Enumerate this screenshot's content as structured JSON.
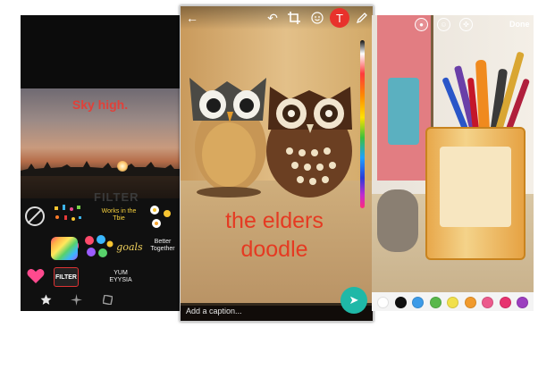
{
  "left_screen": {
    "photo_text": "Sky high.",
    "sticker_filter_big": "FILTER",
    "sticker_filter_badge": "FILTER",
    "sticker_goals": "goals",
    "sticker_together": "Better Together",
    "sticker_kitchen": "Works in the Tbie",
    "sticker_yum": "YUM EYYSIA"
  },
  "center_screen": {
    "doodle_line1": "the elders",
    "doodle_line2": "doodle",
    "caption_placeholder": "Add a caption...",
    "text_tool_label": "T",
    "accent_color": "#e8322c",
    "send_color": "#1fb8a7"
  },
  "right_screen": {
    "done_label": "Done",
    "palette_colors": [
      "#ffffff",
      "#111111",
      "#3c9be8",
      "#59b84c",
      "#f1e04b",
      "#f19a2c",
      "#ec5a8c",
      "#e7336f",
      "#9c3fbf"
    ]
  }
}
